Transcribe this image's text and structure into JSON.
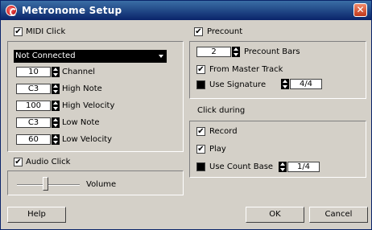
{
  "window": {
    "title": "Metronome Setup",
    "close_symbol": "✕"
  },
  "midi": {
    "header": "MIDI Click",
    "port": "Not Connected",
    "rows": [
      {
        "value": "10",
        "label": "Channel"
      },
      {
        "value": "C3",
        "label": "High Note"
      },
      {
        "value": "100",
        "label": "High Velocity"
      },
      {
        "value": "C3",
        "label": "Low Note"
      },
      {
        "value": "60",
        "label": "Low Velocity"
      }
    ]
  },
  "audio": {
    "header": "Audio Click",
    "volume_label": "Volume",
    "volume_level": 0.45
  },
  "precount": {
    "header": "Precount",
    "bars_value": "2",
    "bars_label": "Precount Bars",
    "master_label": "From Master Track",
    "signature_label": "Use Signature",
    "signature_value": "4/4"
  },
  "click_during": {
    "header": "Click during",
    "record_label": "Record",
    "play_label": "Play",
    "count_base_label": "Use Count Base",
    "count_base_value": "1/4"
  },
  "buttons": {
    "help": "Help",
    "ok": "OK",
    "cancel": "Cancel"
  },
  "icons": {
    "check": "✔",
    "app": "metronome-app-icon"
  },
  "colors": {
    "title_start": "#3a6ea5",
    "title_end": "#0a246a",
    "dialog_bg": "#d4d0c8"
  }
}
